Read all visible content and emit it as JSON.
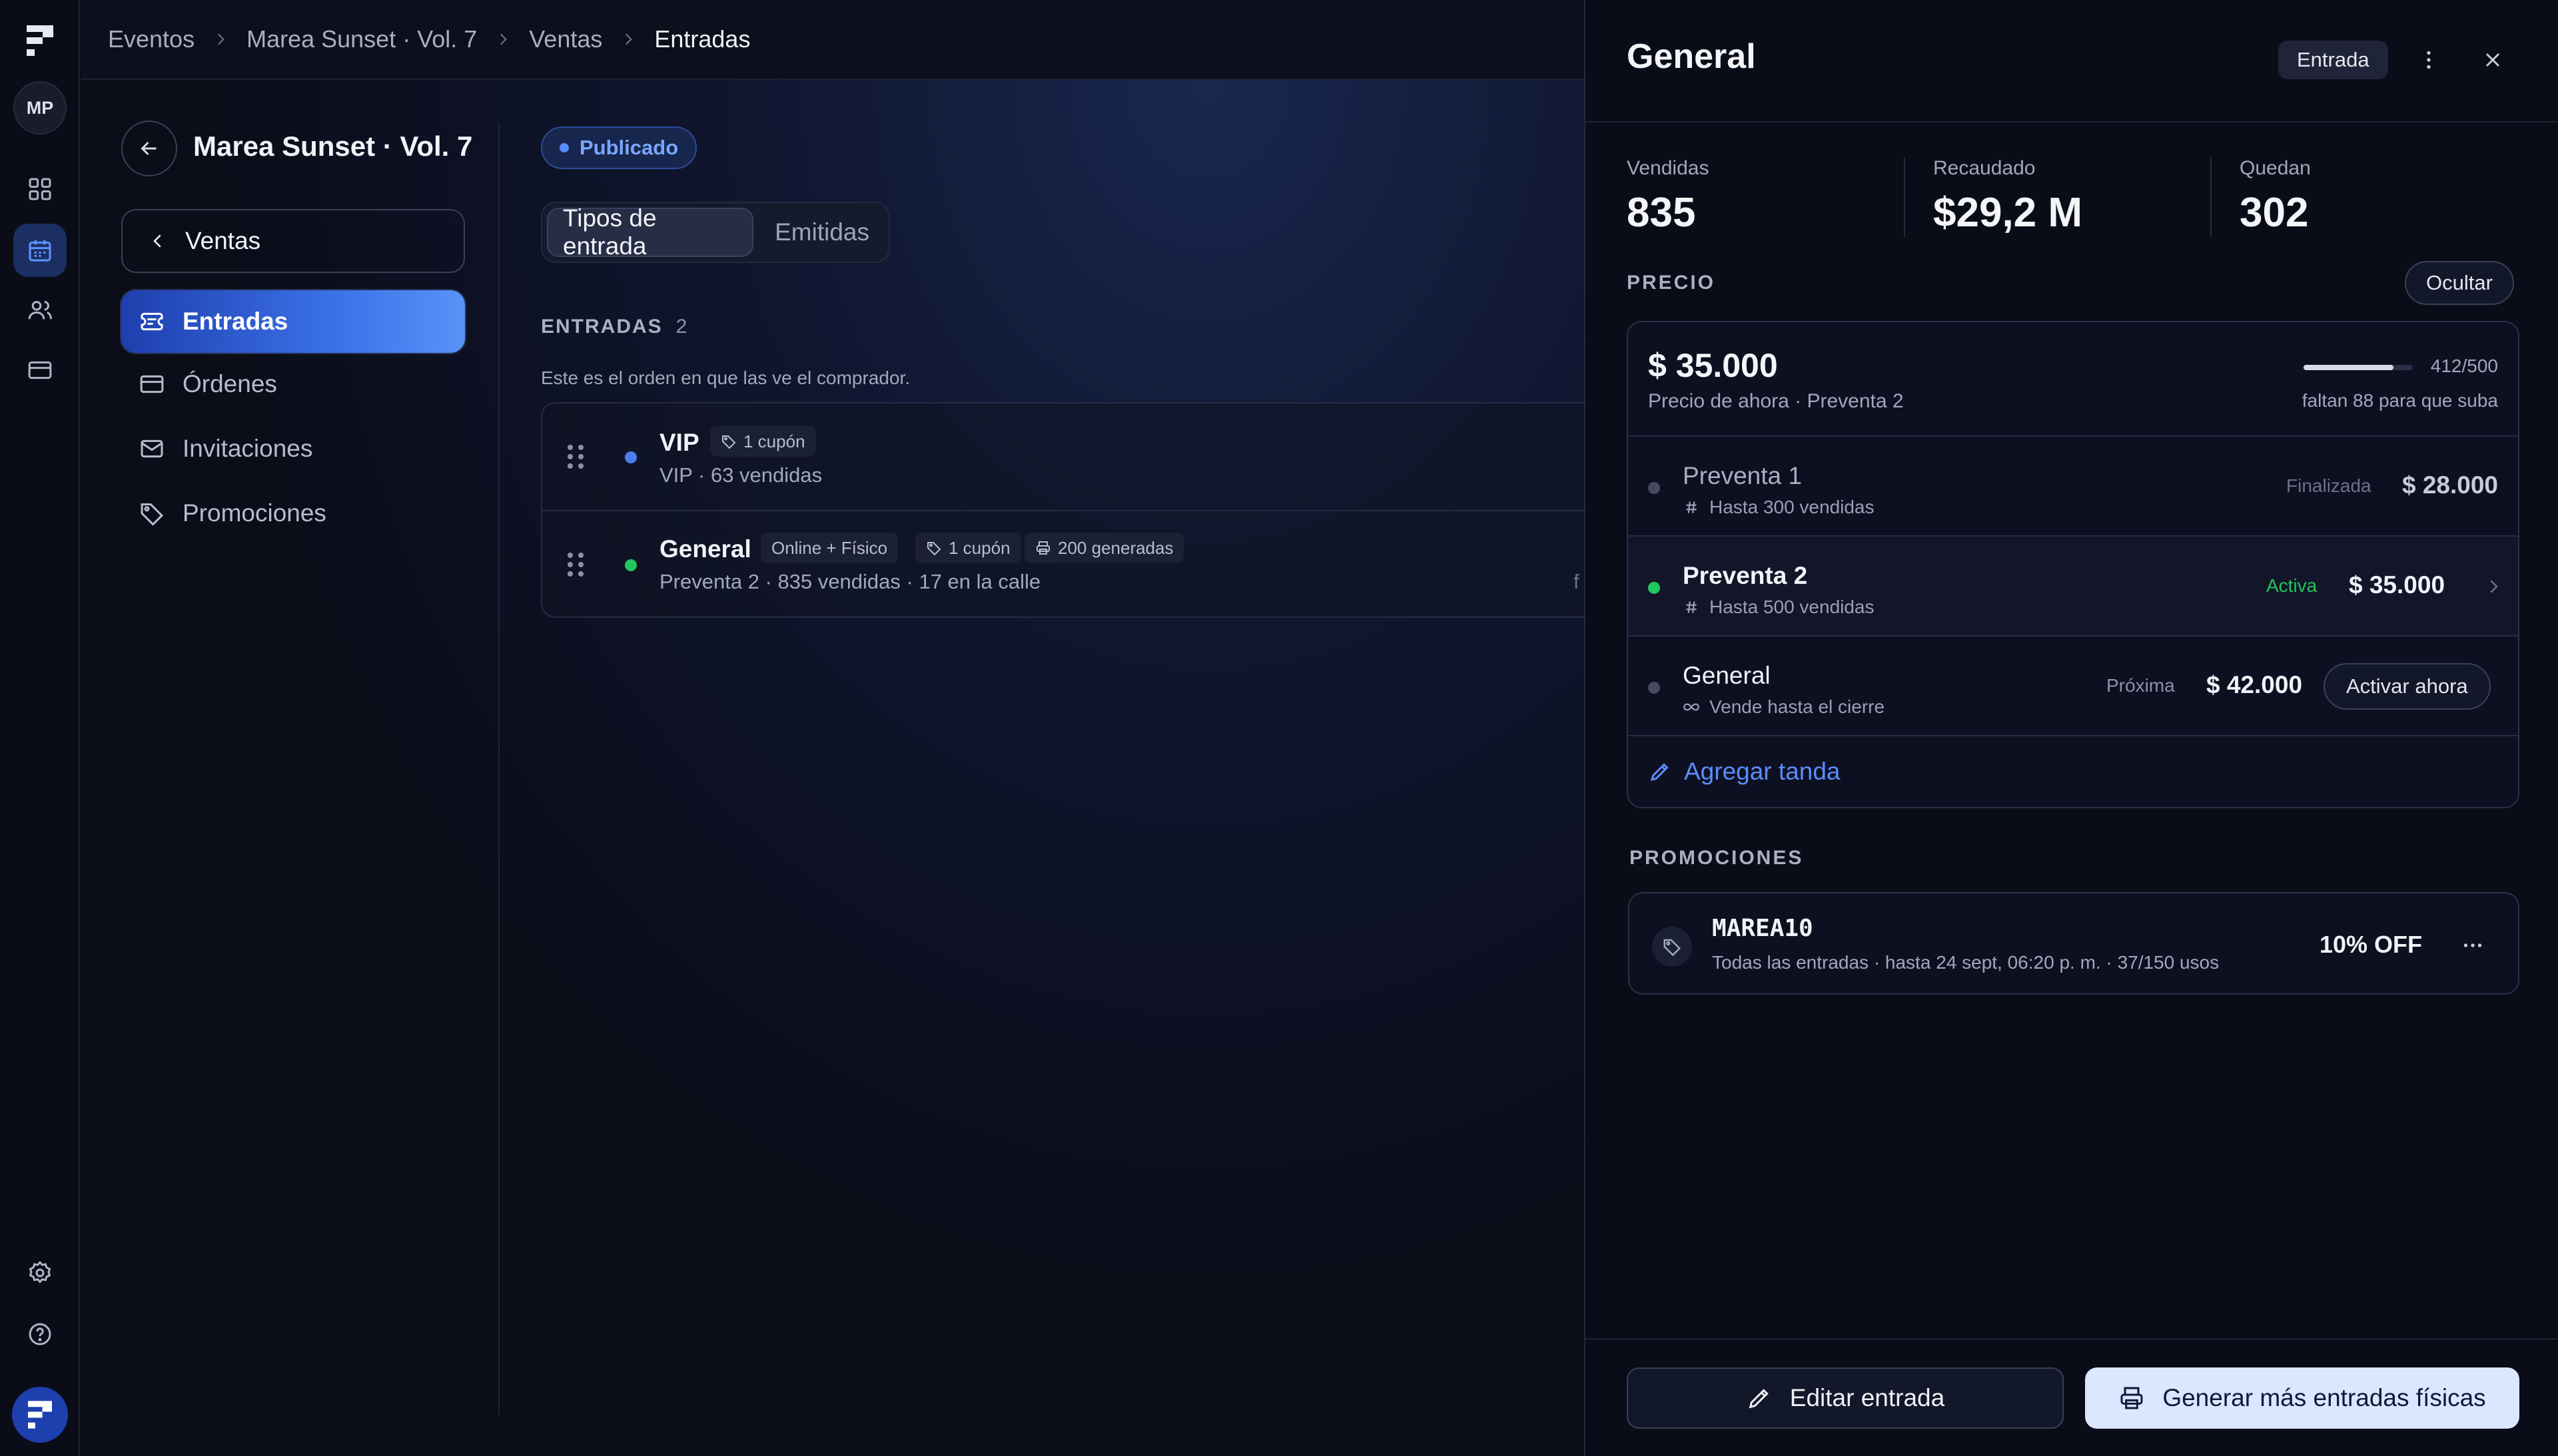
{
  "user": {
    "initials": "MP"
  },
  "breadcrumb": [
    "Eventos",
    "Marea Sunset · Vol. 7",
    "Ventas",
    "Entradas"
  ],
  "event": {
    "title": "Marea Sunset · Vol. 7"
  },
  "sidenav": {
    "back_label": "Ventas",
    "items": [
      {
        "label": "Entradas",
        "icon": "ticket-icon",
        "active": true
      },
      {
        "label": "Órdenes",
        "icon": "card-icon"
      },
      {
        "label": "Invitaciones",
        "icon": "mail-icon"
      },
      {
        "label": "Promociones",
        "icon": "tag-icon"
      }
    ]
  },
  "content": {
    "status": "Publicado",
    "tabs": [
      "Tipos de entrada",
      "Emitidas"
    ],
    "section_title": "ENTRADAS",
    "section_count": "2",
    "note": "Este es el orden en que las ve el comprador.",
    "tickets": [
      {
        "name": "VIP",
        "dot_color": "#4f7df0",
        "chips": [
          "1 cupón"
        ],
        "sub": "VIP · 63 vendidas"
      },
      {
        "name": "General",
        "dot_color": "#22c55e",
        "chips": [
          "Online + Físico",
          "1 cupón",
          "200 generadas"
        ],
        "sub": "Preventa 2 · 835 vendidas · 17 en la calle",
        "clipped": "f"
      }
    ]
  },
  "drawer": {
    "title": "General",
    "tag": "Entrada",
    "stats": [
      {
        "label": "Vendidas",
        "value": "835"
      },
      {
        "label": "Recaudado",
        "value": "$29,2 M"
      },
      {
        "label": "Quedan",
        "value": "302"
      }
    ],
    "price_section": "PRECIO",
    "hide_label": "Ocultar",
    "current_price": "$ 35.000",
    "current_price_sub": "Precio de ahora · Preventa 2",
    "progress_text": "412/500",
    "progress_fraction": 0.824,
    "progress_note": "faltan 88 para que suba",
    "tiers": [
      {
        "name": "Preventa 1",
        "sub": "Hasta 300 vendidas",
        "state": "Finalizada",
        "price": "$ 28.000"
      },
      {
        "name": "Preventa 2",
        "sub": "Hasta 500 vendidas",
        "state": "Activa",
        "price": "$ 35.000"
      },
      {
        "name": "General",
        "sub": "Vende hasta el cierre",
        "state": "Próxima",
        "price": "$ 42.000",
        "action": "Activar ahora"
      }
    ],
    "add_tier": "Agregar tanda",
    "promos_section": "PROMOCIONES",
    "promo": {
      "code": "MAREA10",
      "sub": "Todas las entradas · hasta 24 sept, 06:20 p. m. · 37/150 usos",
      "discount": "10% OFF"
    },
    "edit_button": "Editar entrada",
    "generate_button": "Generar más entradas físicas"
  },
  "colors": {
    "accent": "#5b8cff",
    "success": "#22c55e",
    "background": "#0b0d19"
  }
}
